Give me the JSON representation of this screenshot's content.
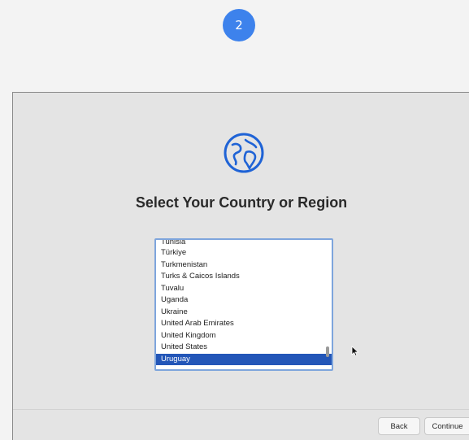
{
  "step_badge": {
    "number": "2",
    "color": "#3d82ec"
  },
  "setup": {
    "icon": "globe-icon",
    "title": "Select Your Country or Region",
    "countries": [
      "Tunisia",
      "Türkiye",
      "Turkmenistan",
      "Turks & Caicos Islands",
      "Tuvalu",
      "Uganda",
      "Ukraine",
      "United Arab Emirates",
      "United Kingdom",
      "United States",
      "Uruguay"
    ],
    "selected_country": "Uruguay",
    "selection_color": "#2356b8",
    "buttons": {
      "back": "Back",
      "continue": "Continue"
    }
  }
}
